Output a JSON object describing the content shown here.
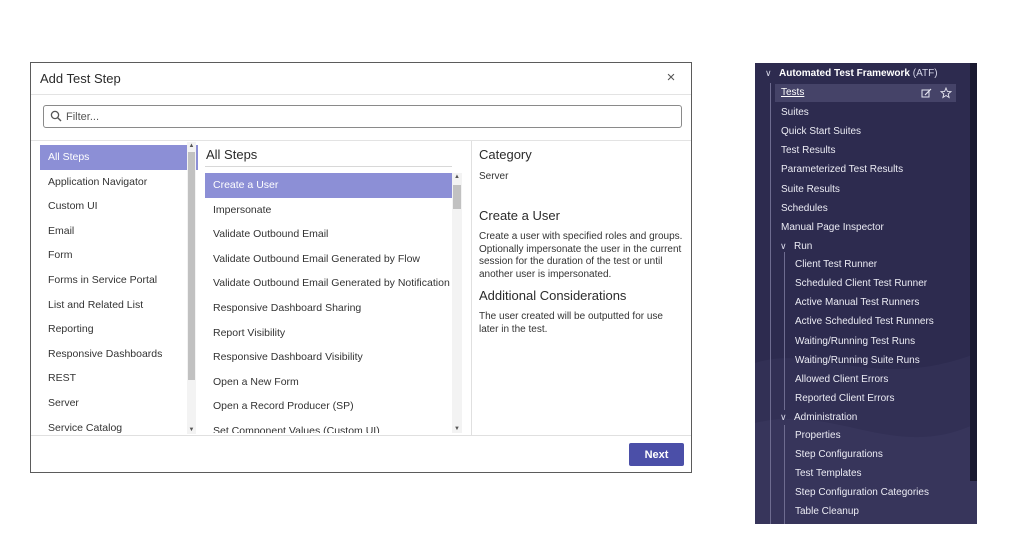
{
  "modal": {
    "title": "Add Test Step",
    "close_glyph": "×",
    "filter_placeholder": "Filter...",
    "categories": [
      "All Steps",
      "Application Navigator",
      "Custom UI",
      "Email",
      "Form",
      "Forms in Service Portal",
      "List and Related List",
      "Reporting",
      "Responsive Dashboards",
      "REST",
      "Server",
      "Service Catalog"
    ],
    "selected_category": "All Steps",
    "steps_title": "All Steps",
    "steps": [
      "Create a User",
      "Impersonate",
      "Validate Outbound Email",
      "Validate Outbound Email Generated by Flow",
      "Validate Outbound Email Generated by Notification",
      "Responsive Dashboard Sharing",
      "Report Visibility",
      "Responsive Dashboard Visibility",
      "Open a New Form",
      "Open a Record Producer (SP)",
      "Set Component Values (Custom UI)"
    ],
    "selected_step": "Create a User",
    "details": {
      "category_heading": "Category",
      "category_value": "Server",
      "step_heading": "Create a User",
      "description": "Create a user with specified roles and groups. Optionally impersonate the user in the current session for the duration of the test or until another user is impersonated.",
      "additional_heading": "Additional Considerations",
      "additional_text": "The user created will be outputted for use later in the test."
    },
    "next_label": "Next",
    "accent_color": "#4b4fa8",
    "selection_color": "#8c8fd6"
  },
  "nav": {
    "section_title": "Automated Test Framework",
    "section_suffix": "(ATF)",
    "active_item": "Tests",
    "items": [
      "Suites",
      "Quick Start Suites",
      "Test Results",
      "Parameterized Test Results",
      "Suite Results",
      "Schedules",
      "Manual Page Inspector"
    ],
    "run_group": {
      "label": "Run",
      "items": [
        "Client Test Runner",
        "Scheduled Client Test Runner",
        "Active Manual Test Runners",
        "Active Scheduled Test Runners",
        "Waiting/Running Test Runs",
        "Waiting/Running Suite Runs",
        "Allowed Client Errors",
        "Reported Client Errors"
      ]
    },
    "admin_group": {
      "label": "Administration",
      "items": [
        "Properties",
        "Step Configurations",
        "Test Templates",
        "Step Configuration Categories",
        "Table Cleanup"
      ]
    },
    "icons": [
      "edit-icon",
      "star-icon"
    ],
    "background_color": "#2d2b4f"
  }
}
